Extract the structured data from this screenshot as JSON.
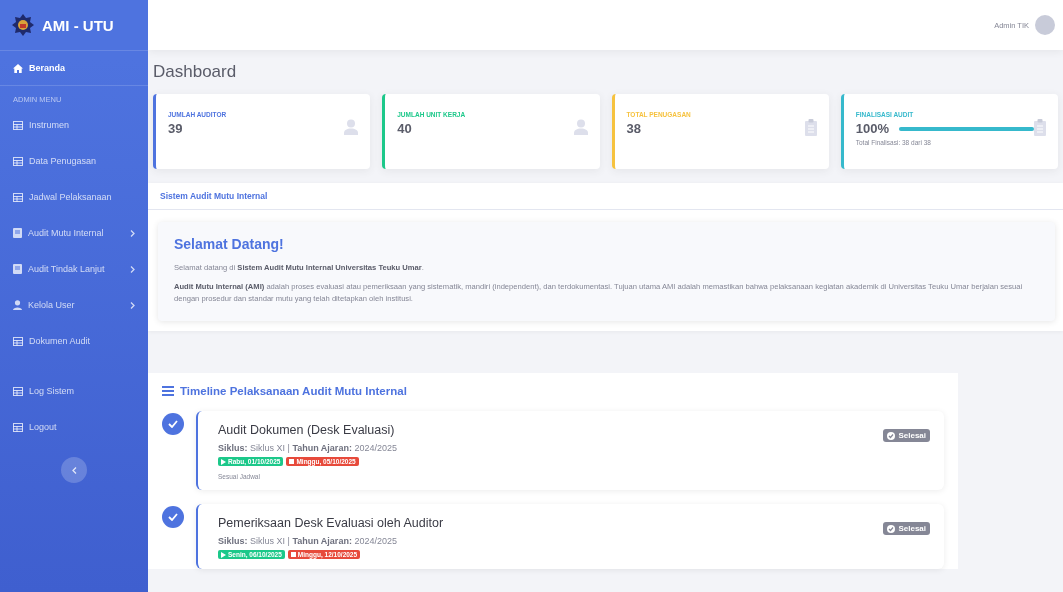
{
  "brand": {
    "title": "AMI - UTU"
  },
  "sidebar": {
    "items": [
      {
        "label": "Beranda",
        "kind": "home",
        "selected": true,
        "has_submenu": false
      },
      {
        "kind": "heading",
        "label": "ADMIN MENU"
      },
      {
        "label": "Instrumen",
        "kind": "table",
        "selected": false,
        "has_submenu": false
      },
      {
        "label": "Data Penugasan",
        "kind": "table",
        "selected": false,
        "has_submenu": false
      },
      {
        "label": "Jadwal Pelaksanaan",
        "kind": "table",
        "selected": false,
        "has_submenu": false
      },
      {
        "label": "Audit Mutu Internal",
        "kind": "book",
        "selected": false,
        "has_submenu": true
      },
      {
        "label": "Audit Tindak Lanjut",
        "kind": "book",
        "selected": false,
        "has_submenu": true
      },
      {
        "label": "Kelola User",
        "kind": "user",
        "selected": false,
        "has_submenu": true
      },
      {
        "label": "Dokumen Audit",
        "kind": "table",
        "selected": false,
        "has_submenu": false
      },
      {
        "kind": "gap"
      },
      {
        "label": "Log Sistem",
        "kind": "table",
        "selected": false,
        "has_submenu": false
      },
      {
        "label": "Logout",
        "kind": "table",
        "selected": false,
        "has_submenu": false
      }
    ]
  },
  "topbar": {
    "user_name": "Admin TIK"
  },
  "page_title": "Dashboard",
  "stats": [
    {
      "label": "JUMLAH AUDITOR",
      "value": "39",
      "color": "#4e73df",
      "kind": "user"
    },
    {
      "label": "JUMLAH UNIT KERJA",
      "value": "40",
      "color": "#1cc88a",
      "kind": "user"
    },
    {
      "label": "TOTAL PENUGASAN",
      "value": "38",
      "color": "#f6c23e",
      "kind": "clipboard"
    },
    {
      "label": "FINALISASI AUDIT",
      "value": "100%",
      "color": "#36b9cc",
      "kind": "clipboard",
      "level": 1.0,
      "caption": "Total Finalisasi: 38 dari 38"
    }
  ],
  "system_panel": {
    "title": "Sistem Audit Mutu Internal",
    "welcome_title": "Selamat Datang!",
    "paragraphs": [
      "Selamat datang di **Sistem Audit Mutu Internal Universitas Teuku Umar**.",
      "**Audit Mutu Internal (AMI)** adalah proses evaluasi atau pemeriksaan yang sistematik, mandiri (independent), dan terdokumentasi. Tujuan utama AMI adalah memastikan bahwa pelaksanaan kegiatan akademik di Universitas Teuku Umar berjalan sesuai dengan prosedur dan standar mutu yang telah ditetapkan oleh institusi."
    ]
  },
  "timeline": {
    "title": "Timeline Pelaksanaan Audit Mutu Internal",
    "items": [
      {
        "title": "Audit Dokumen (Desk Evaluasi)",
        "meta": "**Siklus:** Siklus XI | **Tahun Ajaran:** 2024/2025",
        "start": "Rabu, 01/10/2025",
        "end": "Minggu, 05/10/2025",
        "note": "Sesuai Jadwal",
        "status": "Selesai",
        "done": true
      },
      {
        "title": "Pemeriksaan Desk Evaluasi oleh Auditor",
        "meta": "**Siklus:** Siklus XI | **Tahun Ajaran:** 2024/2025",
        "start": "Senin, 06/10/2025",
        "end": "Minggu, 12/10/2025",
        "status": "Selesai",
        "done": true
      }
    ]
  }
}
